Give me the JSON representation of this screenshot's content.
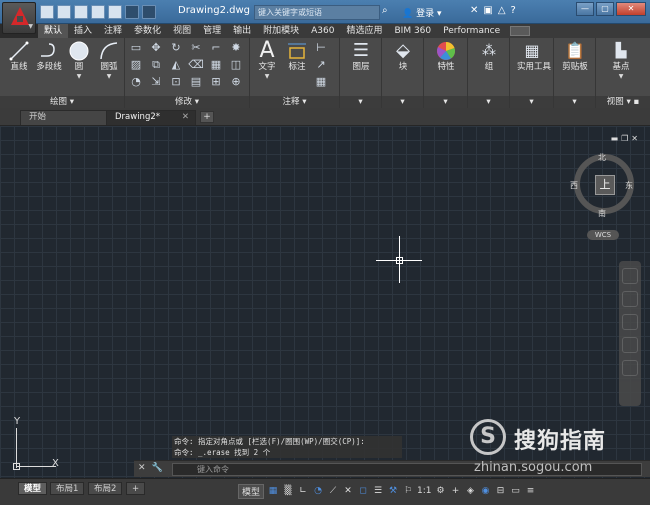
{
  "titlebar": {
    "doc_title": "Drawing2.dwg",
    "search_placeholder": "键入关键字或短语",
    "login": "登录",
    "help": "?"
  },
  "ribbon_tabs": [
    "默认",
    "插入",
    "注释",
    "参数化",
    "视图",
    "管理",
    "输出",
    "附加模块",
    "A360",
    "精选应用",
    "BIM 360",
    "Performance"
  ],
  "panels": {
    "draw": {
      "title": "绘图",
      "buttons": [
        "直线",
        "多段线",
        "圆",
        "圆弧"
      ]
    },
    "modify": {
      "title": "修改"
    },
    "annotation": {
      "title": "注释",
      "buttons": [
        "文字",
        "标注"
      ]
    },
    "layers": {
      "button": "图层"
    },
    "block": {
      "button": "块"
    },
    "properties": {
      "button": "特性"
    },
    "groups": {
      "button": "组"
    },
    "utilities": {
      "button": "实用工具"
    },
    "clipboard": {
      "button": "剪贴板"
    },
    "view": {
      "title": "视图",
      "button": "基点"
    }
  },
  "file_tabs": {
    "start": "开始",
    "drawing": "Drawing2*",
    "new": "+"
  },
  "viewcube": {
    "north": "北",
    "south": "南",
    "east": "东",
    "west": "西",
    "face": "上",
    "wcs": "WCS"
  },
  "ucs": {
    "x": "X",
    "y": "Y"
  },
  "command": {
    "history": [
      "命令: 指定对角点或 [栏选(F)/圈围(WP)/圈交(CP)]:",
      "命令: _.erase 找到 2 个"
    ],
    "placeholder": "键入命令"
  },
  "status": {
    "layout_tabs": [
      "模型",
      "布局1",
      "布局2"
    ],
    "add": "+",
    "model": "模型",
    "scale": "1:1"
  },
  "watermark": {
    "logo": "S",
    "name": "搜狗指南",
    "url": "zhinan.sogou.com"
  }
}
